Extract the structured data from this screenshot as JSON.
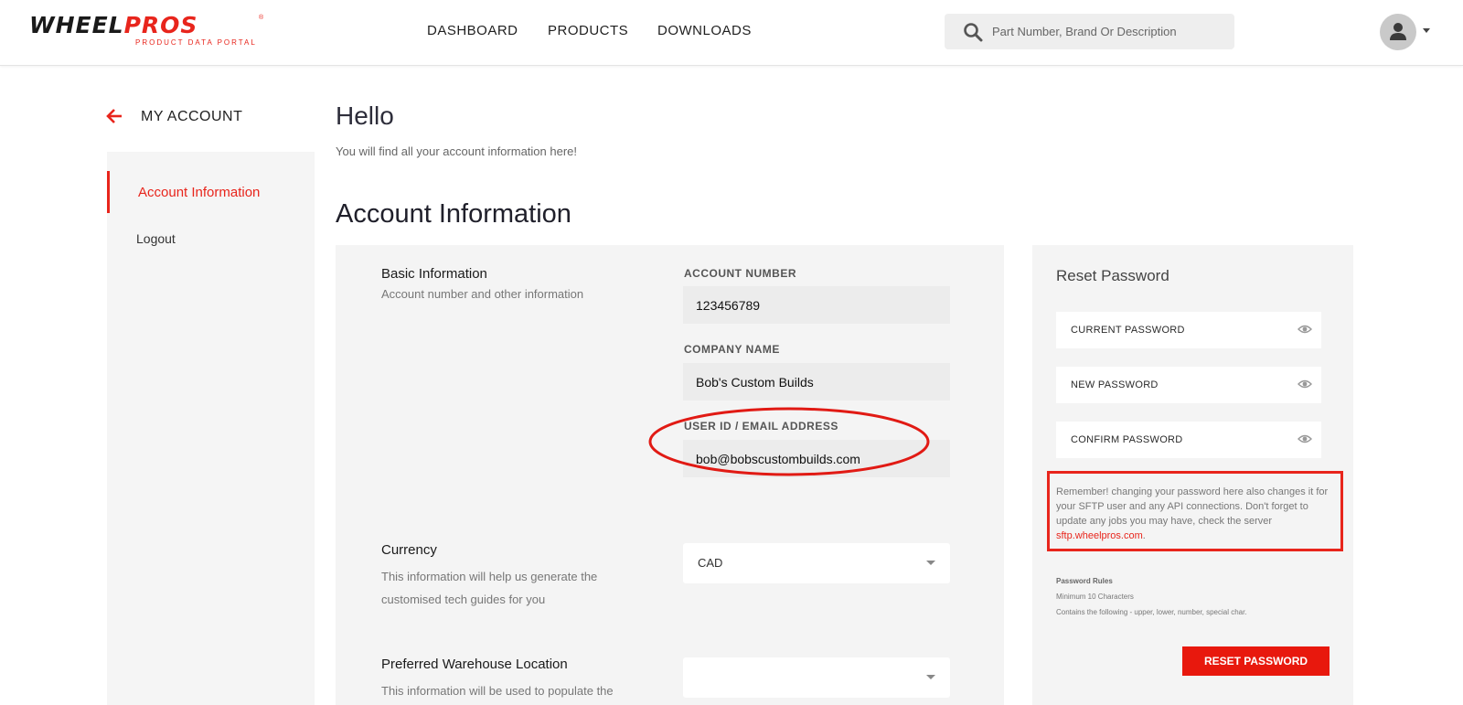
{
  "header": {
    "logo": {
      "brand_first": "WHEEL",
      "brand_second": "PROS",
      "registered": "®",
      "tagline": "PRODUCT DATA PORTAL"
    },
    "nav": [
      {
        "label": "DASHBOARD"
      },
      {
        "label": "PRODUCTS"
      },
      {
        "label": "DOWNLOADS"
      }
    ],
    "search": {
      "placeholder": "Part Number, Brand Or Description",
      "value": ""
    },
    "icons": {
      "search": "search-icon",
      "avatar": "user-icon",
      "menu": "caret-down-icon"
    }
  },
  "sidebar": {
    "title": "MY ACCOUNT",
    "back_icon": "arrow-left-icon",
    "items": [
      {
        "label": "Account Information",
        "active": true
      },
      {
        "label": "Logout",
        "active": false
      }
    ]
  },
  "main": {
    "greeting": "Hello",
    "greeting_sub": "You will find all your account information here!",
    "section_title": "Account Information",
    "basic_info": {
      "title": "Basic Information",
      "description": "Account number and other information",
      "fields": {
        "account_number": {
          "label": "ACCOUNT NUMBER",
          "value": "123456789"
        },
        "company_name": {
          "label": "COMPANY NAME",
          "value": "Bob's Custom Builds"
        },
        "user_email": {
          "label": "USER ID / EMAIL ADDRESS",
          "value": "bob@bobscustombuilds.com"
        }
      }
    },
    "currency": {
      "title": "Currency",
      "description": "This information will help us generate the customised tech guides for you",
      "selected": "CAD"
    },
    "warehouse": {
      "title": "Preferred Warehouse Location",
      "description": "This information will be used to populate the",
      "selected": ""
    }
  },
  "reset_password": {
    "title": "Reset Password",
    "fields": [
      {
        "label": "CURRENT PASSWORD"
      },
      {
        "label": "NEW PASSWORD"
      },
      {
        "label": "CONFIRM PASSWORD"
      }
    ],
    "notice": "Remember! changing your password here also changes it for your SFTP user and any API connections. Don't forget to update any jobs you may have, check the server",
    "notice_link": "sftp.wheelpros.com",
    "notice_end": ".",
    "rules_title": "Password Rules",
    "rules": [
      "Minimum 10 Characters",
      "Contains the following - upper, lower, number, special char."
    ],
    "button_label": "RESET PASSWORD"
  },
  "colors": {
    "accent": "#e8251c",
    "panel": "#f4f4f4",
    "field": "#ececec"
  }
}
